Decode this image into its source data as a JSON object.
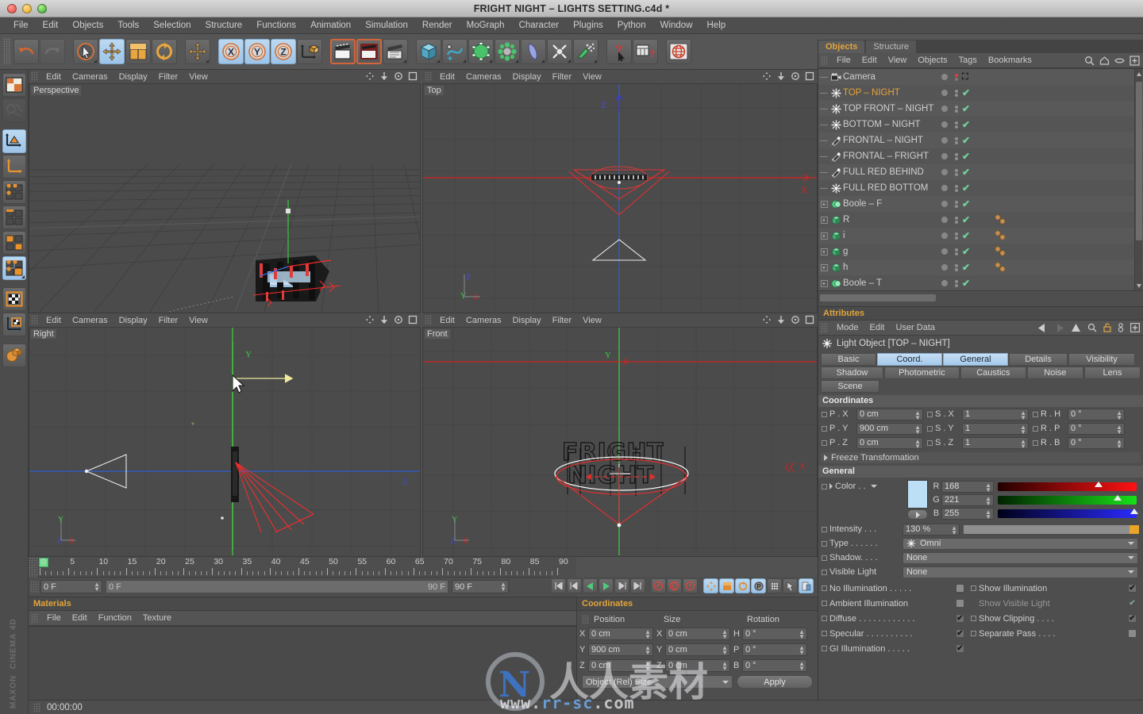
{
  "window": {
    "title": "FRIGHT NIGHT – LIGHTS SETTING.c4d *"
  },
  "menubar": {
    "items": [
      "File",
      "Edit",
      "Objects",
      "Tools",
      "Selection",
      "Structure",
      "Functions",
      "Animation",
      "Simulation",
      "Render",
      "MoGraph",
      "Character",
      "Plugins",
      "Python",
      "Window",
      "Help"
    ]
  },
  "toolbar": {
    "groups": [
      {
        "buttons": [
          {
            "icon": "undo-icon",
            "state": "normal"
          },
          {
            "icon": "redo-icon",
            "state": "disabled"
          }
        ]
      },
      {
        "buttons": [
          {
            "icon": "live-selection-icon",
            "state": "normal",
            "corner": true
          },
          {
            "icon": "move-tool-icon",
            "state": "active"
          },
          {
            "icon": "scale-tool-icon",
            "state": "normal"
          },
          {
            "icon": "rotate-tool-icon",
            "state": "normal"
          }
        ]
      },
      {
        "buttons": [
          {
            "icon": "axis-move-icon",
            "state": "normal",
            "corner": true
          }
        ]
      },
      {
        "buttons": [
          {
            "icon": "x-axis-lock-icon",
            "state": "active"
          },
          {
            "icon": "y-axis-lock-icon",
            "state": "active"
          },
          {
            "icon": "z-axis-lock-icon",
            "state": "active"
          },
          {
            "icon": "world-object-axis-icon",
            "state": "normal"
          }
        ]
      },
      {
        "buttons": [
          {
            "icon": "render-view-icon",
            "state": "highlight"
          },
          {
            "icon": "render-region-icon",
            "state": "highlight"
          },
          {
            "icon": "render-settings-icon",
            "state": "normal",
            "corner": true
          }
        ]
      },
      {
        "buttons": [
          {
            "icon": "cube-primitive-icon",
            "state": "normal",
            "corner": true
          },
          {
            "icon": "spline-pen-icon",
            "state": "normal",
            "corner": true
          },
          {
            "icon": "nurbs-icon",
            "state": "normal",
            "corner": true
          },
          {
            "icon": "array-icon",
            "state": "normal",
            "corner": true
          },
          {
            "icon": "bend-deformer-icon",
            "state": "normal",
            "corner": true
          },
          {
            "icon": "light-icon",
            "state": "normal",
            "corner": true
          },
          {
            "icon": "particle-emitter-icon",
            "state": "normal",
            "corner": true
          }
        ]
      },
      {
        "buttons": [
          {
            "icon": "help-cursor-icon",
            "state": "normal"
          },
          {
            "icon": "content-browser-icon",
            "state": "normal"
          }
        ]
      },
      {
        "buttons": [
          {
            "icon": "web-globe-icon",
            "state": "normal"
          }
        ]
      }
    ]
  },
  "left_palette": {
    "buttons": [
      {
        "icon": "layout-manager-icon",
        "state": "normal"
      },
      {
        "icon": "undo-view-icon",
        "state": "disabled"
      },
      {
        "icon": "object-mode-icon",
        "state": "active"
      },
      {
        "icon": "model-axis-mode-icon",
        "state": "normal"
      },
      {
        "icon": "point-mode-icon",
        "state": "normal"
      },
      {
        "icon": "edge-mode-icon",
        "state": "normal"
      },
      {
        "icon": "polygon-mode-icon",
        "state": "normal"
      },
      {
        "icon": "animation-mode-icon",
        "state": "active",
        "corner": true
      },
      {
        "icon": "texture-mode-icon",
        "state": "normal"
      },
      {
        "icon": "texture-axis-mode-icon",
        "state": "normal"
      },
      {
        "icon": "workplane-icon",
        "state": "normal"
      }
    ],
    "brand": "MAXON\nCINEMA 4D"
  },
  "viewports": [
    {
      "name": "perspective",
      "label": "Perspective",
      "menu": [
        "Edit",
        "Cameras",
        "Display",
        "Filter",
        "View"
      ]
    },
    {
      "name": "top",
      "label": "Top",
      "menu": [
        "Edit",
        "Cameras",
        "Display",
        "Filter",
        "View"
      ]
    },
    {
      "name": "right",
      "label": "Right",
      "menu": [
        "Edit",
        "Cameras",
        "Display",
        "Filter",
        "View"
      ]
    },
    {
      "name": "front",
      "label": "Front",
      "menu": [
        "Edit",
        "Cameras",
        "Display",
        "Filter",
        "View"
      ]
    }
  ],
  "timeline": {
    "ticks": [
      0,
      5,
      10,
      15,
      20,
      25,
      30,
      35,
      40,
      45,
      50,
      55,
      60,
      65,
      70,
      75,
      80,
      85,
      90
    ],
    "current_frame": "0 F",
    "range_start": "0 F",
    "range_end": "90 F",
    "max_frame": "90 F",
    "marker_frame": 0,
    "transport": [
      "go-to-start-icon",
      "step-back-icon",
      "play-reverse-icon",
      "play-icon",
      "step-forward-icon",
      "go-to-end-icon"
    ],
    "record": [
      "record-keyframe-icon",
      "autokey-icon",
      "keyframe-selection-icon"
    ],
    "modes": [
      "position-key-icon",
      "scale-key-icon",
      "rotation-key-icon",
      "param-key-icon",
      "point-level-key-icon",
      "animation-mode-icon",
      "keyframe-mode-icon"
    ]
  },
  "materials": {
    "title": "Materials",
    "menu": [
      "File",
      "Edit",
      "Function",
      "Texture"
    ]
  },
  "coordinates_panel": {
    "title": "Coordinates",
    "headers": [
      "Position",
      "Size",
      "Rotation"
    ],
    "rows": [
      {
        "axis": "X",
        "position": "0 cm",
        "size_axis": "X",
        "size": "0 cm",
        "rot_axis": "H",
        "rotation": "0 °"
      },
      {
        "axis": "Y",
        "position": "900 cm",
        "size_axis": "Y",
        "size": "0 cm",
        "rot_axis": "P",
        "rotation": "0 °"
      },
      {
        "axis": "Z",
        "position": "0 cm",
        "size_axis": "Z",
        "size": "0 cm",
        "rot_axis": "B",
        "rotation": "0 °"
      }
    ],
    "system": "Object (Rel) Size",
    "apply_label": "Apply"
  },
  "statusbar": {
    "time": "00:00:00"
  },
  "object_manager": {
    "tabs": [
      {
        "label": "Objects",
        "active": true
      },
      {
        "label": "Structure",
        "active": false
      }
    ],
    "menu": [
      "File",
      "Edit",
      "View",
      "Objects",
      "Tags",
      "Bookmarks"
    ],
    "header_icons": [
      "search-icon",
      "home-icon",
      "eye-icon",
      "add-layer-icon"
    ],
    "items": [
      {
        "label": "Camera",
        "icon": "camera-icon",
        "selected": false,
        "expandable": false,
        "visibility": "red",
        "tag": "protection-tag",
        "tags": 0
      },
      {
        "label": "TOP – NIGHT",
        "icon": "omni-light-icon",
        "selected": true,
        "expandable": false,
        "visibility": "green",
        "tags": 0
      },
      {
        "label": "TOP FRONT – NIGHT",
        "icon": "omni-light-icon",
        "selected": false,
        "expandable": false,
        "visibility": "green",
        "tags": 0
      },
      {
        "label": "BOTTOM – NIGHT",
        "icon": "omni-light-icon",
        "selected": false,
        "expandable": false,
        "visibility": "green",
        "tags": 0
      },
      {
        "label": "FRONTAL – NIGHT",
        "icon": "spot-light-icon",
        "selected": false,
        "expandable": false,
        "visibility": "green",
        "tags": 0
      },
      {
        "label": "FRONTAL – FRIGHT",
        "icon": "spot-light-icon",
        "selected": false,
        "expandable": false,
        "visibility": "green",
        "tags": 0
      },
      {
        "label": "FULL RED BEHIND",
        "icon": "spot-light-icon",
        "selected": false,
        "expandable": false,
        "visibility": "green",
        "tags": 0
      },
      {
        "label": "FULL RED BOTTOM",
        "icon": "omni-light-icon",
        "selected": false,
        "expandable": false,
        "visibility": "green",
        "tags": 0
      },
      {
        "label": "Boole – F",
        "icon": "boole-icon",
        "selected": false,
        "expandable": true,
        "visibility": "green",
        "tags": 0
      },
      {
        "label": "R",
        "icon": "extrude-icon",
        "selected": false,
        "expandable": true,
        "visibility": "green",
        "tags": 2
      },
      {
        "label": "i",
        "icon": "extrude-icon",
        "selected": false,
        "expandable": true,
        "visibility": "green",
        "tags": 2
      },
      {
        "label": "g",
        "icon": "extrude-icon",
        "selected": false,
        "expandable": true,
        "visibility": "green",
        "tags": 2
      },
      {
        "label": "h",
        "icon": "extrude-icon",
        "selected": false,
        "expandable": true,
        "visibility": "green",
        "tags": 2
      },
      {
        "label": "Boole – T",
        "icon": "boole-icon",
        "selected": false,
        "expandable": true,
        "visibility": "green",
        "tags": 0
      }
    ]
  },
  "attributes": {
    "title": "Attributes",
    "menu": [
      "Mode",
      "Edit",
      "User Data"
    ],
    "header_icons": [
      "back-arrow-icon",
      "forward-arrow-icon",
      "up-arrow-icon",
      "search-icon",
      "lock-icon",
      "link-icon",
      "add-icon"
    ],
    "object_header": "Light Object [TOP – NIGHT]",
    "object_icon": "omni-light-icon",
    "tabs": [
      [
        {
          "label": "Basic",
          "selected": false
        },
        {
          "label": "Coord.",
          "selected": true
        },
        {
          "label": "General",
          "selected": true
        },
        {
          "label": "Details",
          "selected": false
        },
        {
          "label": "Visibility",
          "selected": false
        }
      ],
      [
        {
          "label": "Shadow",
          "selected": false
        },
        {
          "label": "Photometric",
          "selected": false
        },
        {
          "label": "Caustics",
          "selected": false
        },
        {
          "label": "Noise",
          "selected": false
        },
        {
          "label": "Lens",
          "selected": false
        }
      ],
      [
        {
          "label": "Scene",
          "selected": false
        }
      ]
    ],
    "coordinates": {
      "section": "Coordinates",
      "rows": [
        {
          "p_label": "P . X",
          "p_value": "0 cm",
          "s_label": "S . X",
          "s_value": "1",
          "r_label": "R . H",
          "r_value": "0 °"
        },
        {
          "p_label": "P . Y",
          "p_value": "900 cm",
          "s_label": "S . Y",
          "s_value": "1",
          "r_label": "R . P",
          "r_value": "0 °"
        },
        {
          "p_label": "P . Z",
          "p_value": "0 cm",
          "s_label": "S . Z",
          "s_value": "1",
          "r_label": "R . B",
          "r_value": "0 °"
        }
      ],
      "freeze": "Freeze Transformation"
    },
    "general": {
      "section": "General",
      "color_label": "Color . .",
      "color_swatch": "#bddff5",
      "channels": [
        {
          "name": "R",
          "value": "168",
          "knob_pct": 72.5
        },
        {
          "name": "G",
          "value": "221",
          "knob_pct": 86.0
        },
        {
          "name": "B",
          "value": "255",
          "knob_pct": 98.5
        }
      ],
      "intensity_label": "Intensity . . .",
      "intensity_value": "130 %",
      "intensity_pct": 100,
      "intensity_color": "#e8a52a",
      "type_label": "Type . . . . . .",
      "type_value": "Omni",
      "shadow_label": "Shadow. . . .",
      "shadow_value": "None",
      "visible_light_label": "Visible Light",
      "visible_light_value": "None",
      "checks_left": [
        {
          "label": "No Illumination . . . . .",
          "checked": false
        },
        {
          "label": "Ambient Illumination",
          "checked": false
        },
        {
          "label": "Diffuse . . . . . . . . . . . .",
          "checked": true
        },
        {
          "label": "Specular . . . . . . . . . .",
          "checked": true
        },
        {
          "label": "GI Illumination . . . . .",
          "checked": true
        }
      ],
      "checks_right": [
        {
          "label": "Show Illumination",
          "checked": true,
          "disabled": false
        },
        {
          "label": "Show Visible Light",
          "checked": true,
          "disabled": true
        },
        {
          "label": "Show Clipping . . . .",
          "checked": true,
          "disabled": false
        },
        {
          "label": "Separate Pass . . . .",
          "checked": false,
          "disabled": false
        }
      ]
    }
  },
  "watermark": {
    "brand": "CN",
    "url_prefix": "www.",
    "url_mid": "rr-sc",
    "url_suffix": ".com"
  }
}
